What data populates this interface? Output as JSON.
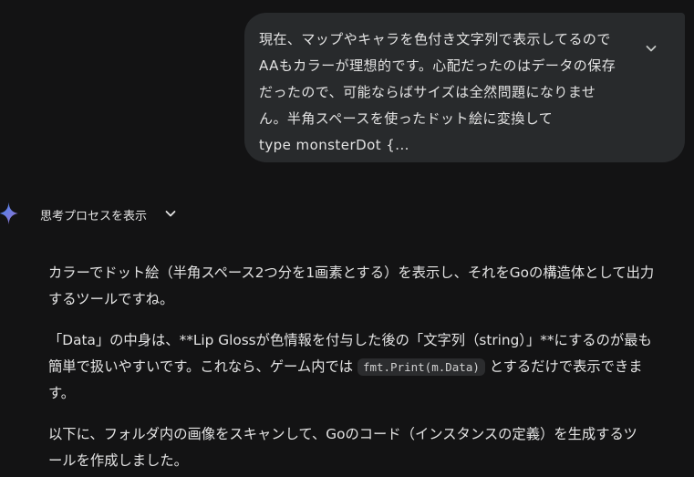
{
  "user_message": {
    "lines": [
      "現在、マップやキャラを色付き文字列で表示してるので",
      "AAもカラーが理想的です。心配だったのはデータの保存",
      "だったので、可能ならばサイズは全然問題になりませ",
      "ん。半角スペースを使ったドット絵に変換して",
      "type monsterDot {..."
    ],
    "expand_icon": "chevron-down-icon"
  },
  "thinking": {
    "label": "思考プロセスを表示",
    "icon": "gemini-spark-icon",
    "spark_colors": [
      "#4285f4",
      "#9b72cb"
    ]
  },
  "response": {
    "p1": {
      "line1": "カラーでドット絵（半角スペース2つ分を1画素とする）を表示し、それをGoの構造体として出力",
      "line2": "するツールですね。"
    },
    "p2": {
      "line1": "「Data」の中身は、**Lip Glossが色情報を付与した後の「文字列（string）」**にするのが最も",
      "line2_before": "簡単で扱いやすいです。これなら、ゲーム内では ",
      "line2_code": "fmt.Print(m.Data)",
      "line2_after": " とするだけで表示できま",
      "line3": "す。"
    },
    "p3": {
      "line1": "以下に、フォルダ内の画像をスキャンして、Goのコード（インスタンスの定義）を生成するツ",
      "line2": "ールを作成しました。"
    }
  }
}
